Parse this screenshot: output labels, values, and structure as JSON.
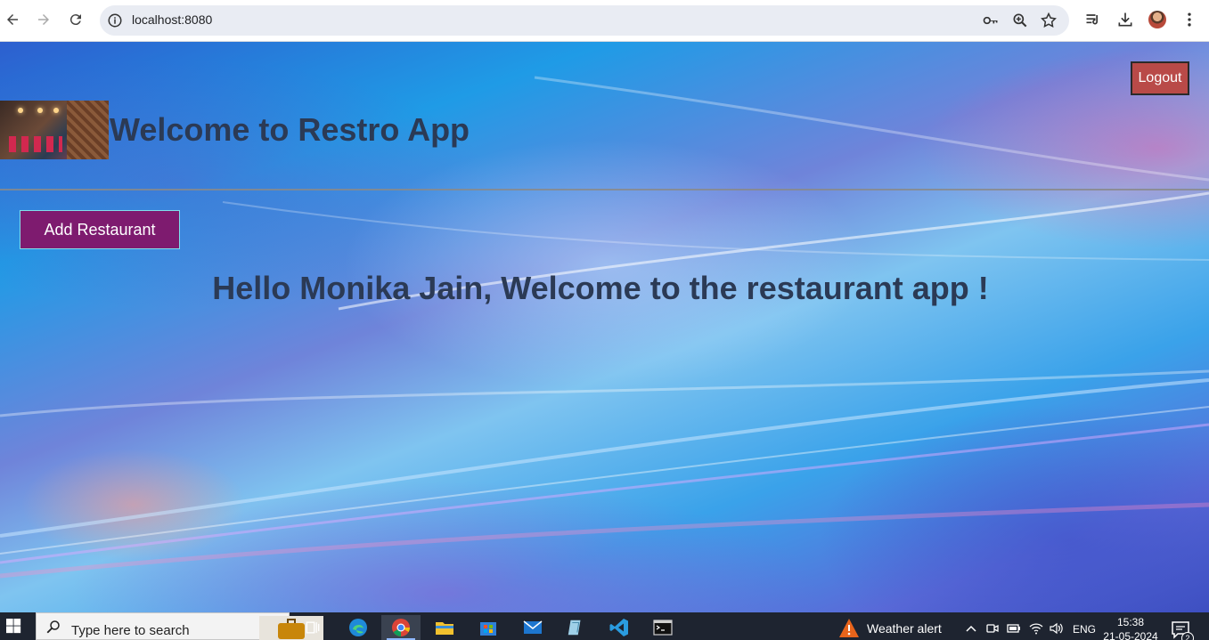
{
  "browser": {
    "url": "localhost:8080"
  },
  "page": {
    "logout_label": "Logout",
    "app_title": "Welcome to Restro App",
    "add_restaurant_label": "Add Restaurant",
    "welcome_message": "Hello Monika Jain, Welcome to the restaurant app !"
  },
  "taskbar": {
    "search_placeholder": "Type here to search",
    "weather_label": "Weather alert",
    "language": "ENG",
    "time": "15:38",
    "date": "21-05-2024",
    "notification_count": "2"
  },
  "colors": {
    "logout_bg": "#b94a48",
    "add_restaurant_bg": "#7e1b6f",
    "add_restaurant_border": "#7fe0ea",
    "heading_text": "#2b3a55",
    "taskbar_bg": "#1e2430"
  }
}
